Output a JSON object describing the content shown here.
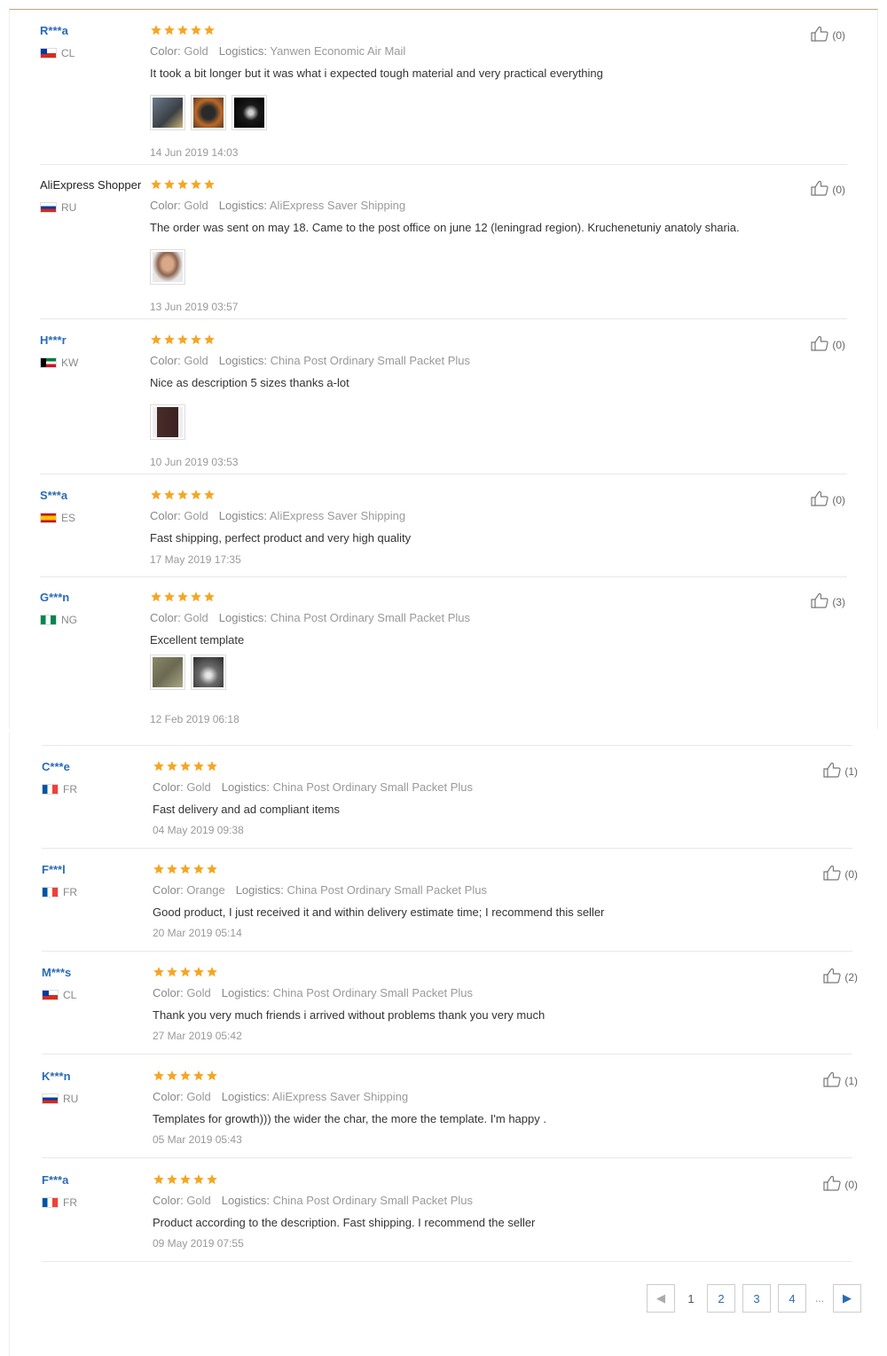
{
  "colors": {
    "star": "#f5a623",
    "buyer_link": "#2a6bb5",
    "divider": "#e8e8e8"
  },
  "labels": {
    "color": "Color:",
    "logistics": "Logistics:"
  },
  "reviews_top": [
    {
      "buyer": "R***a",
      "country": "CL",
      "color": "Gold",
      "logistics": "Yanwen Economic Air Mail",
      "text": "It took a bit longer but it was what i expected tough material and very practical everything",
      "date": "14 Jun 2019 14:03",
      "helpful": "(0)",
      "photos": 3
    },
    {
      "buyer": "AliExpress Shopper",
      "country": "RU",
      "color": "Gold",
      "logistics": "AliExpress Saver Shipping",
      "text": "The order was sent on may 18. Came to the post office on june 12 (leningrad region). Kruchenetuniy anatoly sharia.",
      "date": "13 Jun 2019 03:57",
      "helpful": "(0)",
      "photos": 1
    },
    {
      "buyer": "H***r",
      "country": "KW",
      "color": "Gold",
      "logistics": "China Post Ordinary Small Packet Plus",
      "text": "Nice as description 5 sizes thanks a-lot",
      "date": "10 Jun 2019 03:53",
      "helpful": "(0)",
      "photos": 1
    },
    {
      "buyer": "S***a",
      "country": "ES",
      "color": "Gold",
      "logistics": "AliExpress Saver Shipping",
      "text": "Fast shipping, perfect product and very high quality",
      "date": "17 May 2019 17:35",
      "helpful": "(0)",
      "photos": 0
    },
    {
      "buyer": "G***n",
      "country": "NG",
      "color": "Gold",
      "logistics": "China Post Ordinary Small Packet Plus",
      "text": "Excellent template",
      "date": "12 Feb 2019 06:18",
      "helpful": "(3)",
      "photos": 2
    }
  ],
  "reviews_bottom": [
    {
      "buyer": "C***e",
      "country": "FR",
      "color": "Gold",
      "logistics": "China Post Ordinary Small Packet Plus",
      "text": "Fast delivery and ad compliant items",
      "date": "04 May 2019 09:38",
      "helpful": "(1)"
    },
    {
      "buyer": "F***l",
      "country": "FR",
      "color": "Orange",
      "logistics": "China Post Ordinary Small Packet Plus",
      "text": "Good product, I just received it and within delivery estimate time; I recommend this seller",
      "date": "20 Mar 2019 05:14",
      "helpful": "(0)"
    },
    {
      "buyer": "M***s",
      "country": "CL",
      "color": "Gold",
      "logistics": "China Post Ordinary Small Packet Plus",
      "text": "Thank you very much friends i arrived without problems thank you very much",
      "date": "27 Mar 2019 05:42",
      "helpful": "(2)"
    },
    {
      "buyer": "K***n",
      "country": "RU",
      "color": "Gold",
      "logistics": "AliExpress Saver Shipping",
      "text": "Templates for growth))) the wider the char, the more the template. I'm happy .",
      "date": "05 Mar 2019 05:43",
      "helpful": "(1)"
    },
    {
      "buyer": "F***a",
      "country": "FR",
      "color": "Gold",
      "logistics": "China Post Ordinary Small Packet Plus",
      "text": "Product according to the description. Fast shipping. I recommend the seller",
      "date": "09 May 2019 07:55",
      "helpful": "(0)"
    }
  ],
  "pagination": {
    "pages": [
      "1",
      "2",
      "3",
      "4"
    ],
    "ellipsis": "...",
    "current": "1"
  }
}
